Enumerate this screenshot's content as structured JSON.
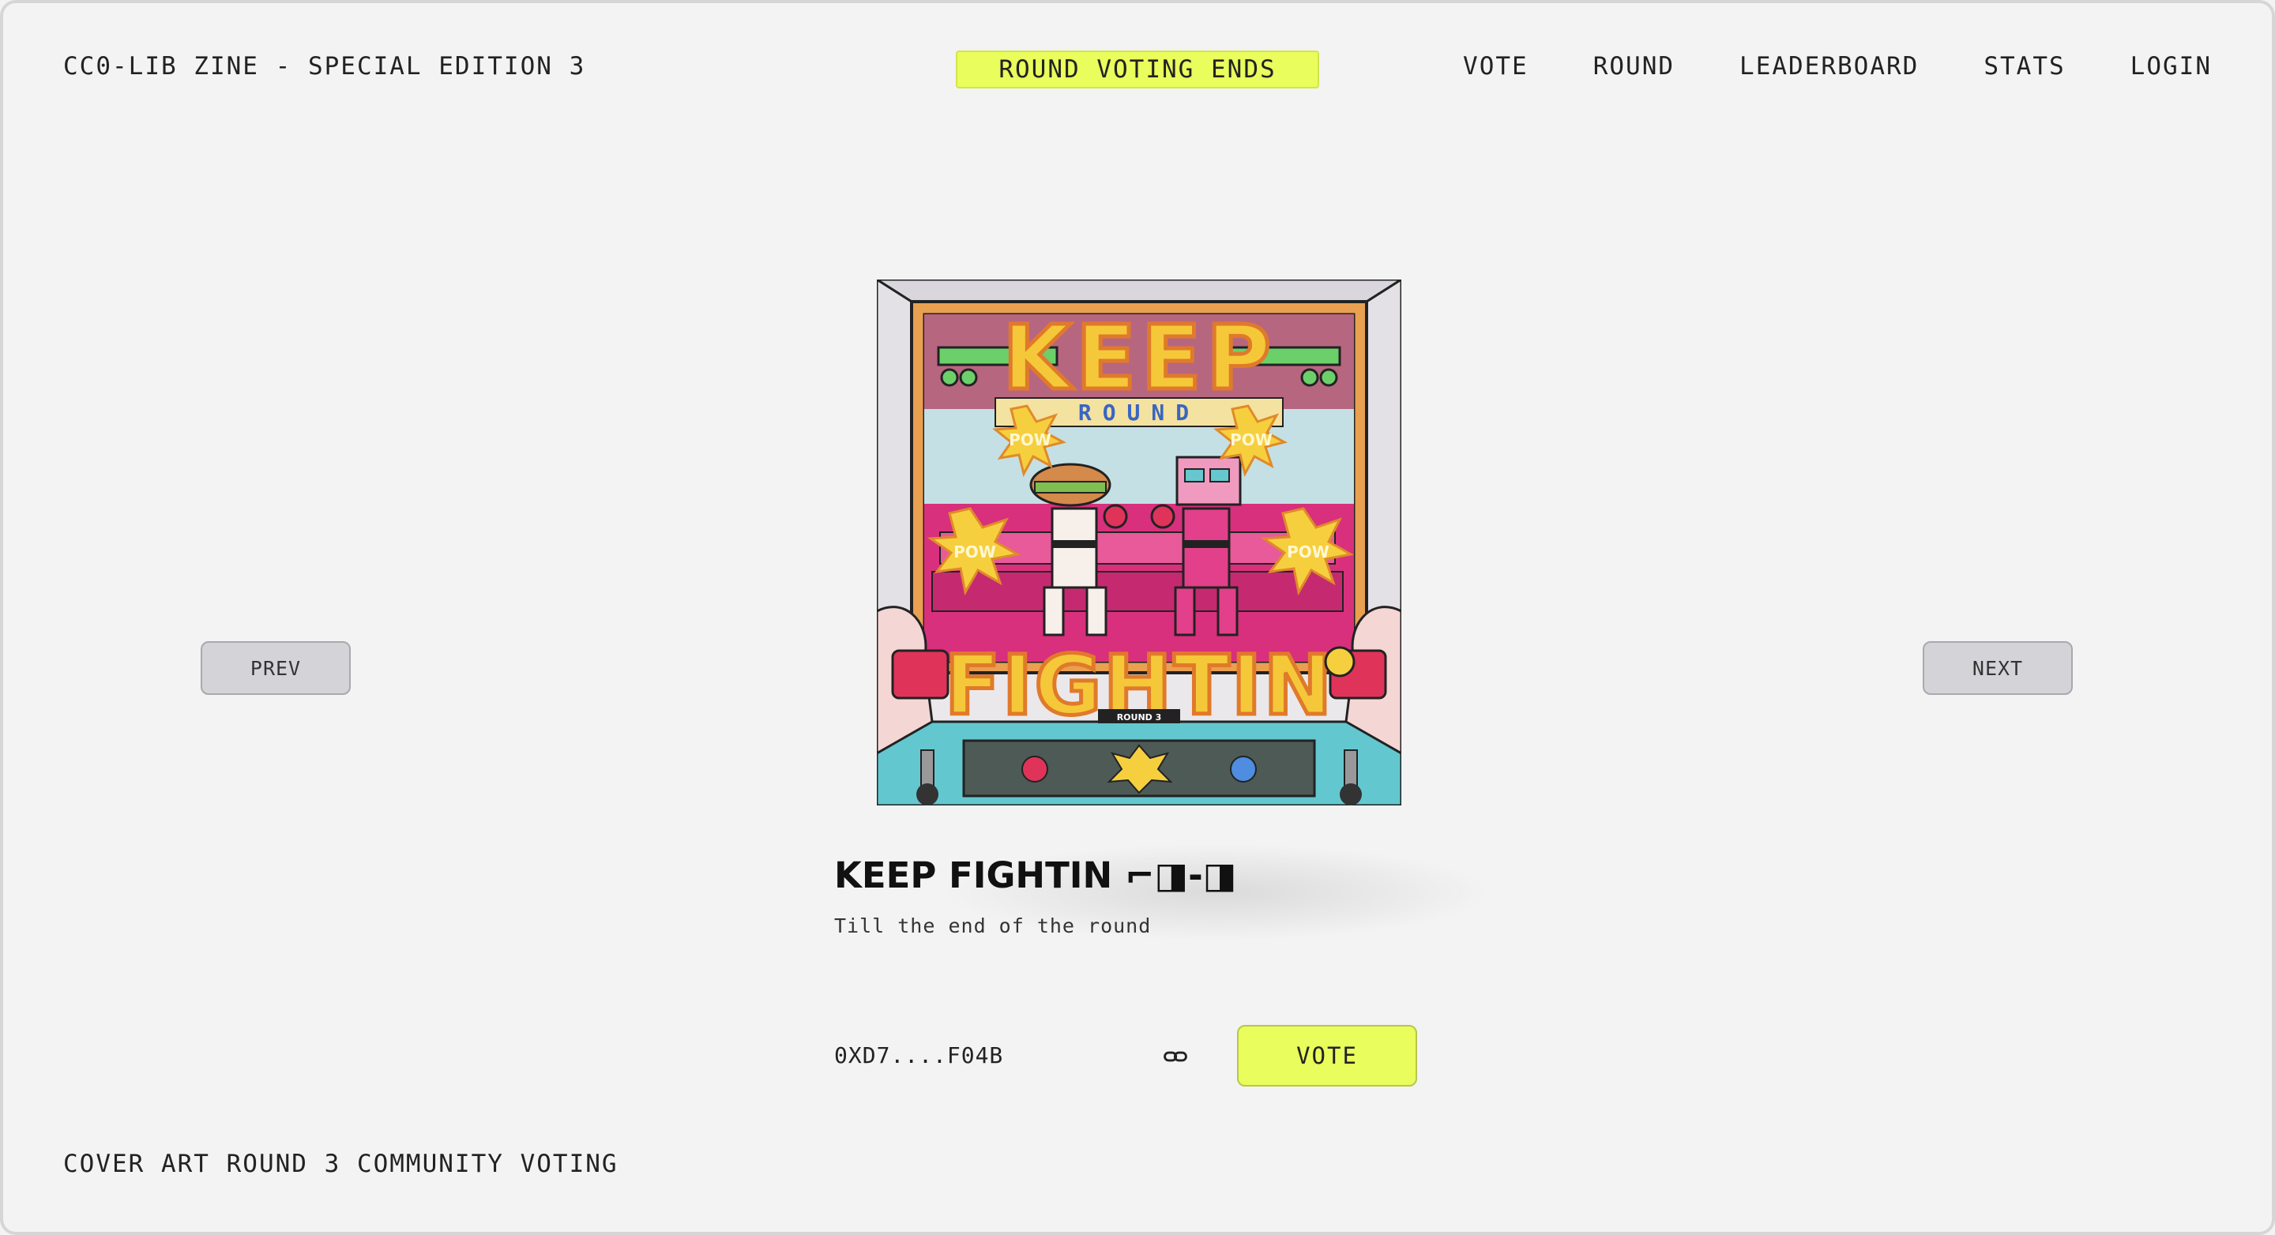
{
  "header": {
    "site_title": "CC0-LIB ZINE - SPECIAL EDITION 3",
    "countdown_label": "ROUND VOTING ENDS",
    "nav": [
      "VOTE",
      "ROUND",
      "LEADERBOARD",
      "STATS",
      "LOGIN"
    ]
  },
  "carousel": {
    "prev_label": "PREV",
    "next_label": "NEXT"
  },
  "artwork": {
    "top_text": "KEEP",
    "bottom_text": "FIGHTIN",
    "banner_text": "ROUND",
    "pow_text": "POW",
    "plate_text": "ROUND 3"
  },
  "entry": {
    "title": "KEEP FIGHTIN ⌐◨-◨",
    "subtitle": "Till the end of the round",
    "wallet": "0XD7....F04B",
    "vote_label": "VOTE"
  },
  "footer": {
    "text": "COVER ART ROUND 3 COMMUNITY VOTING"
  },
  "colors": {
    "background": "#f3f3f3",
    "accent": "#e9fd5c",
    "button_gray": "#d4d4d8"
  },
  "icons": {
    "link": "link-icon"
  }
}
